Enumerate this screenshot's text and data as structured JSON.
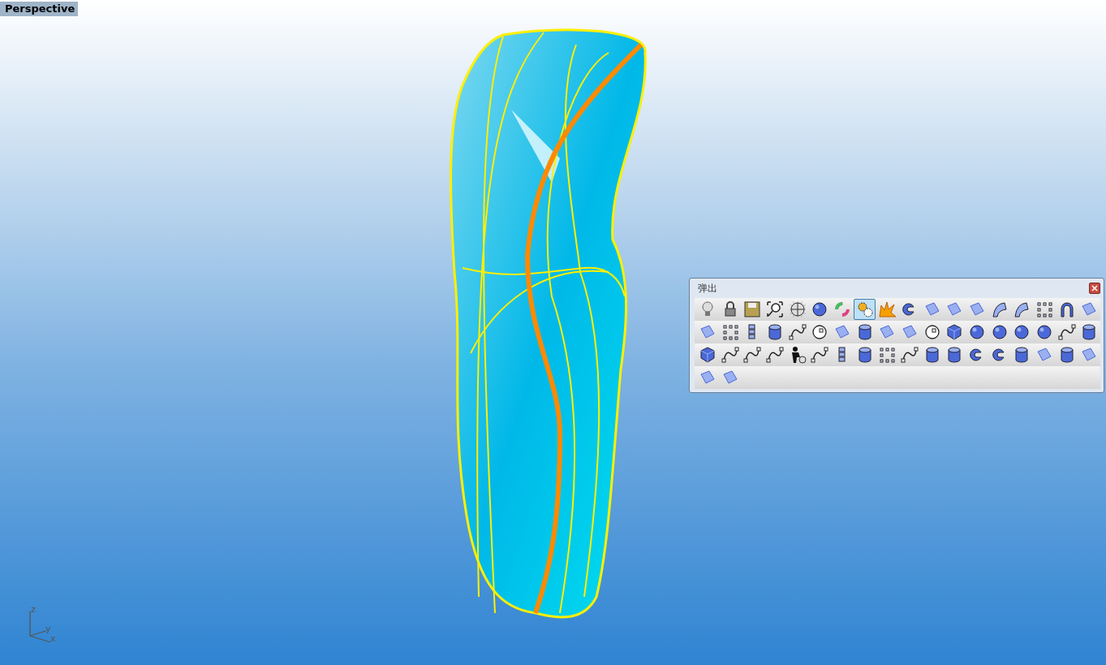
{
  "viewport": {
    "label": "Perspective",
    "axes": {
      "z": "z",
      "y": "y",
      "x": "x"
    }
  },
  "toolbar": {
    "title": "弹出",
    "rows": [
      [
        {
          "kind": "bulb",
          "selected": false
        },
        {
          "kind": "lock",
          "selected": false
        },
        {
          "kind": "disk",
          "selected": false
        },
        {
          "kind": "zoom",
          "selected": false
        },
        {
          "kind": "gridsphere",
          "selected": false
        },
        {
          "kind": "sphere",
          "selected": false
        },
        {
          "kind": "wheel",
          "selected": false
        },
        {
          "kind": "gear",
          "selected": true
        },
        {
          "kind": "burst",
          "selected": false
        },
        {
          "kind": "curl",
          "selected": false
        },
        {
          "kind": "surface",
          "selected": false
        },
        {
          "kind": "surface",
          "selected": false
        },
        {
          "kind": "surface",
          "selected": false
        },
        {
          "kind": "arc",
          "selected": false
        },
        {
          "kind": "arc",
          "selected": false
        },
        {
          "kind": "dots",
          "selected": false
        },
        {
          "kind": "arch",
          "selected": false
        },
        {
          "kind": "surface",
          "selected": false
        }
      ],
      [
        {
          "kind": "surface",
          "selected": false
        },
        {
          "kind": "dots",
          "selected": false
        },
        {
          "kind": "bar",
          "selected": false
        },
        {
          "kind": "cylinder",
          "selected": false
        },
        {
          "kind": "curve",
          "selected": false
        },
        {
          "kind": "circle",
          "selected": false
        },
        {
          "kind": "surface",
          "selected": false
        },
        {
          "kind": "cylinder",
          "selected": false
        },
        {
          "kind": "surface",
          "selected": false
        },
        {
          "kind": "surface",
          "selected": false
        },
        {
          "kind": "circle",
          "selected": false
        },
        {
          "kind": "box",
          "selected": false
        },
        {
          "kind": "sphere",
          "selected": false
        },
        {
          "kind": "sphere",
          "selected": false
        },
        {
          "kind": "sphere",
          "selected": false
        },
        {
          "kind": "sphere",
          "selected": false
        },
        {
          "kind": "curve",
          "selected": false
        },
        {
          "kind": "cylinder",
          "selected": false
        }
      ],
      [
        {
          "kind": "box",
          "selected": false
        },
        {
          "kind": "curve",
          "selected": false
        },
        {
          "kind": "curve",
          "selected": false
        },
        {
          "kind": "curve",
          "selected": false
        },
        {
          "kind": "person",
          "selected": false
        },
        {
          "kind": "curve",
          "selected": false
        },
        {
          "kind": "bar",
          "selected": false
        },
        {
          "kind": "cylinder",
          "selected": false
        },
        {
          "kind": "dots",
          "selected": false
        },
        {
          "kind": "curve",
          "selected": false
        },
        {
          "kind": "cylinder",
          "selected": false
        },
        {
          "kind": "cylinder",
          "selected": false
        },
        {
          "kind": "curl",
          "selected": false
        },
        {
          "kind": "curl",
          "selected": false
        },
        {
          "kind": "cylinder",
          "selected": false
        },
        {
          "kind": "surface",
          "selected": false
        },
        {
          "kind": "cylinder",
          "selected": false
        },
        {
          "kind": "surface",
          "selected": false
        }
      ],
      [
        {
          "kind": "surface",
          "selected": false
        },
        {
          "kind": "surface",
          "selected": false
        }
      ]
    ]
  }
}
